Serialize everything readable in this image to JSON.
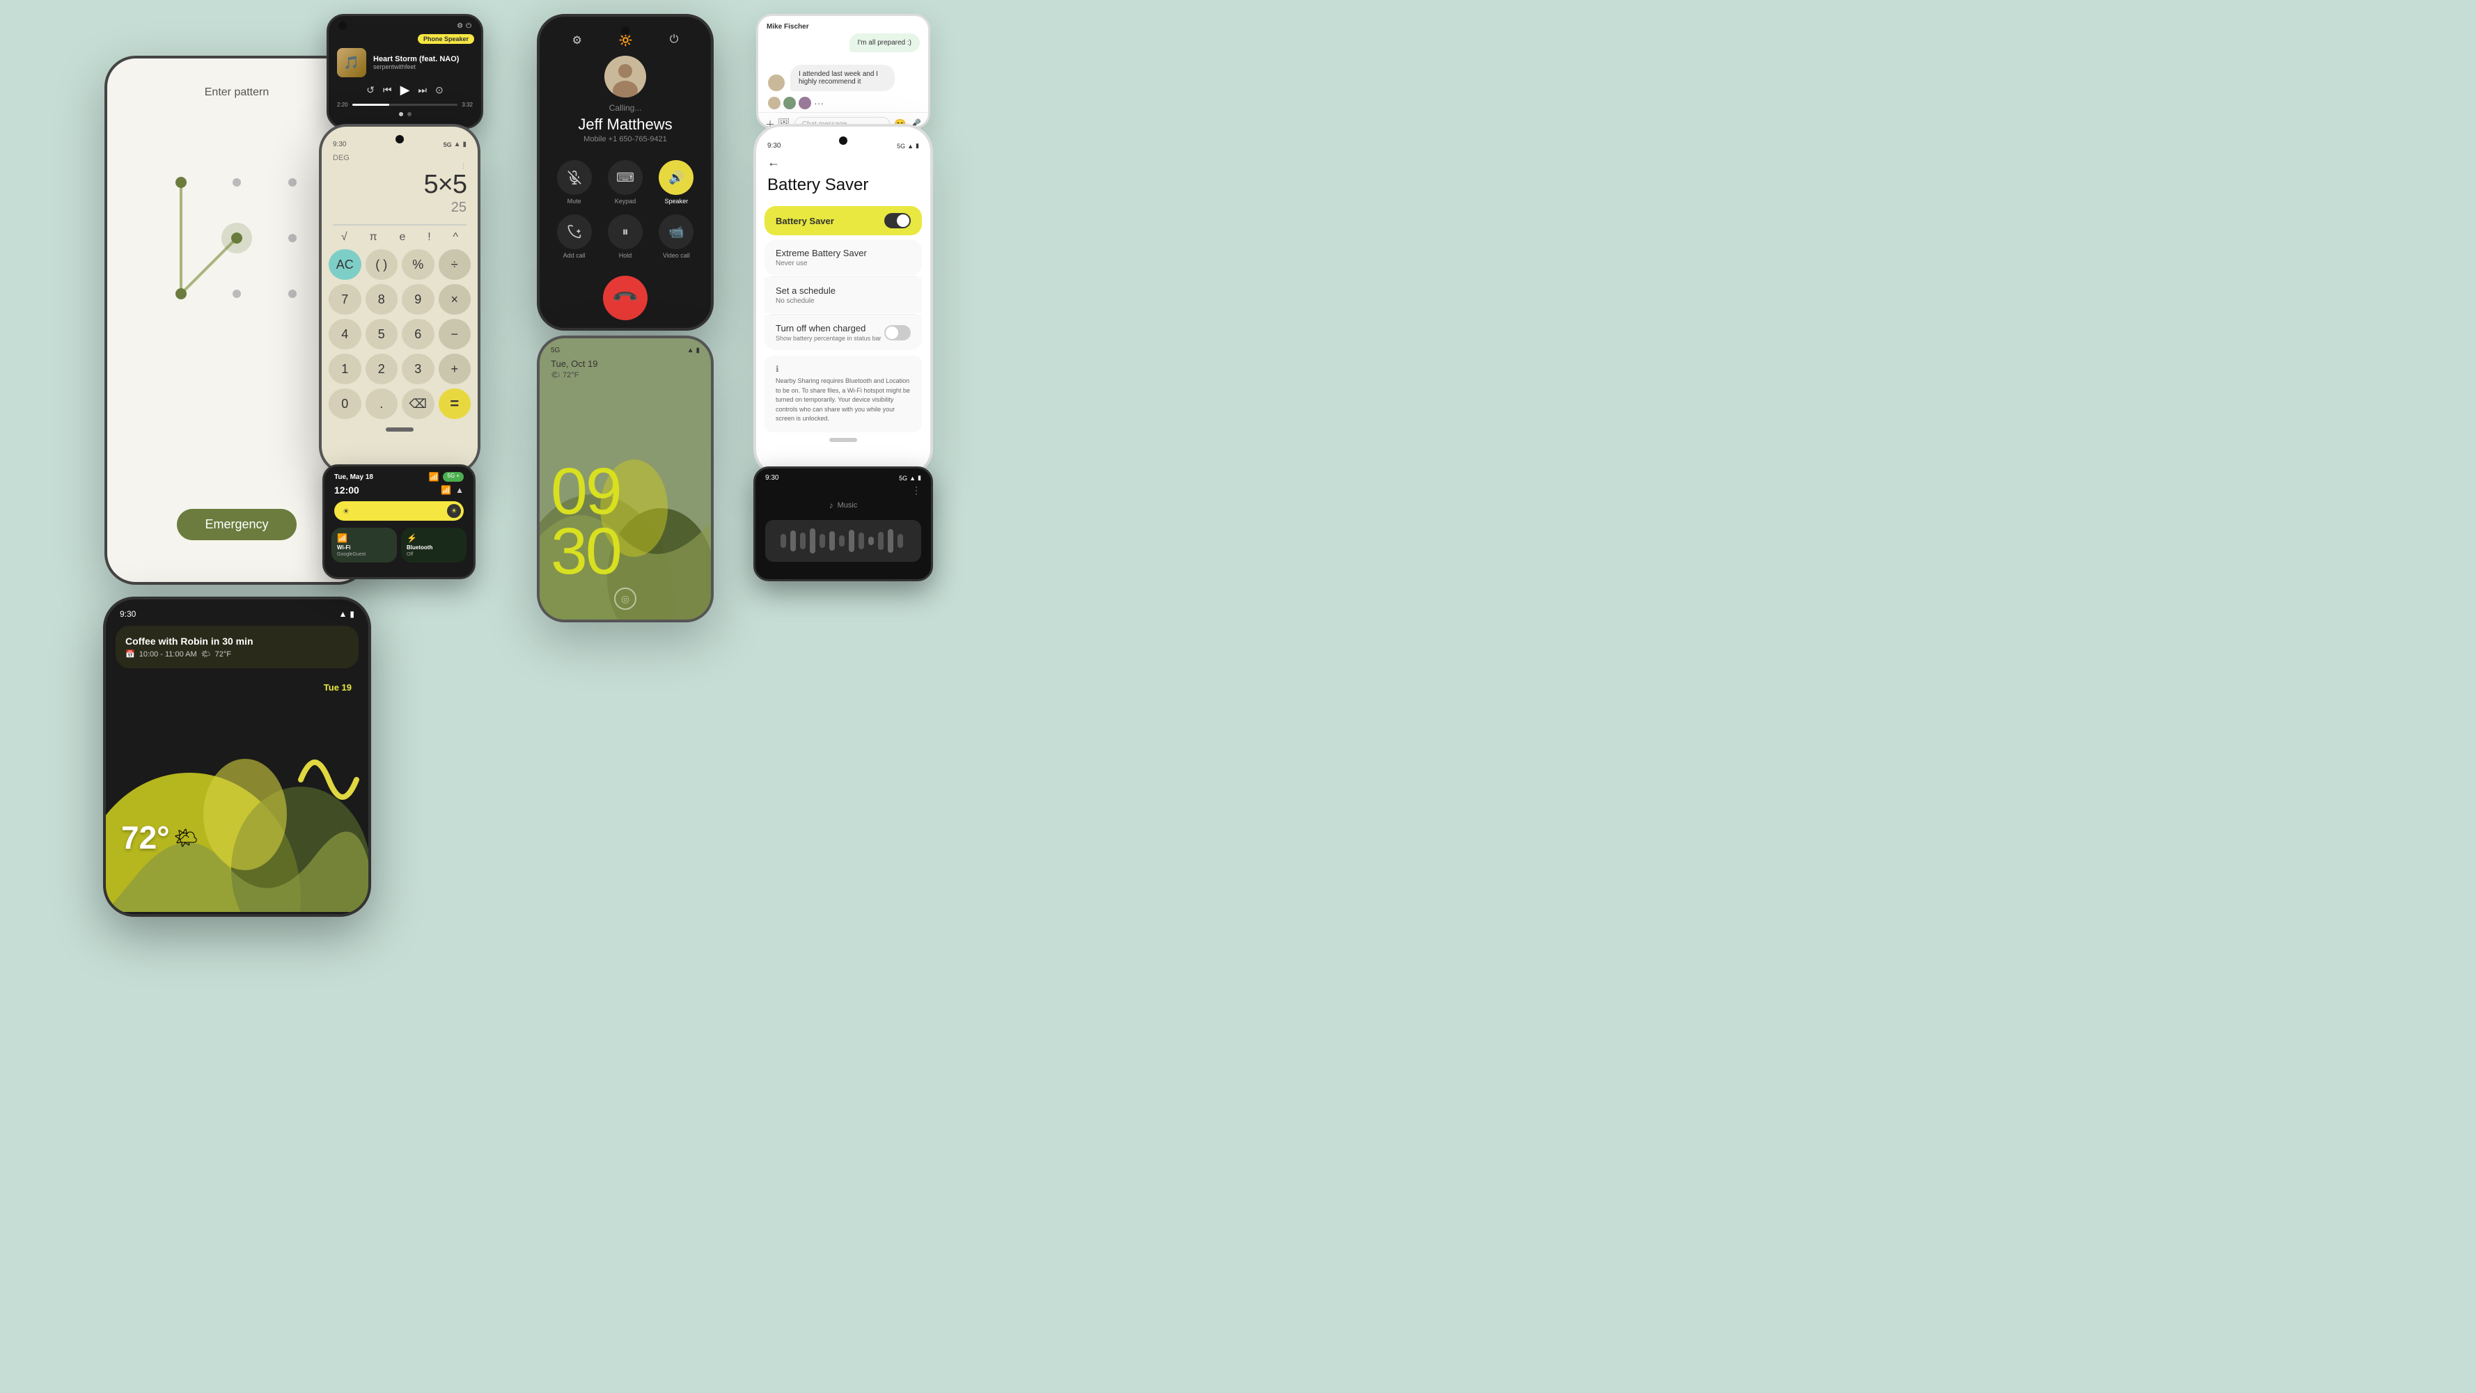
{
  "bg_color": "#c5ddd4",
  "phone1": {
    "enter_text": "Enter pattern",
    "emergency_label": "Emergency",
    "dots": [
      {
        "active": false
      },
      {
        "active": false
      },
      {
        "active": false
      },
      {
        "active": false
      },
      {
        "active": false
      },
      {
        "active": false
      },
      {
        "active": false
      },
      {
        "active": false
      },
      {
        "active": false
      }
    ]
  },
  "phone2": {
    "status_time": "9:30",
    "event_title": "Coffee with Robin in 30 min",
    "event_time": "10:00 - 11:00 AM",
    "event_weather": "72°F",
    "date_label": "Tue 19",
    "temp": "72°"
  },
  "phone3": {
    "pill_label": "Phone Speaker",
    "song_title": "Heart Storm (feat. NAO)",
    "artist": "serpentwithfeet",
    "time_current": "2:20",
    "time_total": "3:32"
  },
  "phone4": {
    "status_time": "9:30",
    "signal": "5G",
    "mode": "DEG",
    "expression": "5×5",
    "result": "25",
    "buttons": [
      {
        "label": "√",
        "type": "op"
      },
      {
        "label": "π",
        "type": "op"
      },
      {
        "label": "e",
        "type": "op"
      },
      {
        "label": "!",
        "type": "op"
      },
      {
        "label": "^",
        "type": "op"
      },
      {
        "label": "AC",
        "type": "teal"
      },
      {
        "label": "()",
        "type": "gray"
      },
      {
        "label": "%",
        "type": "gray"
      },
      {
        "label": "÷",
        "type": "op"
      },
      {
        "label": "7",
        "type": "gray"
      },
      {
        "label": "8",
        "type": "gray"
      },
      {
        "label": "9",
        "type": "gray"
      },
      {
        "label": "×",
        "type": "op"
      },
      {
        "label": "4",
        "type": "gray"
      },
      {
        "label": "5",
        "type": "gray"
      },
      {
        "label": "6",
        "type": "gray"
      },
      {
        "label": "−",
        "type": "op"
      },
      {
        "label": "1",
        "type": "gray"
      },
      {
        "label": "2",
        "type": "gray"
      },
      {
        "label": "3",
        "type": "gray"
      },
      {
        "label": "+",
        "type": "op"
      },
      {
        "label": "0",
        "type": "gray"
      },
      {
        "label": ".",
        "type": "gray"
      },
      {
        "label": "⌫",
        "type": "gray"
      },
      {
        "label": "=",
        "type": "yellow"
      }
    ]
  },
  "phone5": {
    "date": "Tue, May 18",
    "badge": "5G +",
    "time": "12:00",
    "wifi_name": "GoogleGuest",
    "wifi_label": "Wi-Fi",
    "bt_label": "Bluetooth",
    "bt_sub": "Off"
  },
  "phone6": {
    "calling_label": "Calling...",
    "contact_name": "Jeff Matthews",
    "phone_number": "Mobile +1 650-765-9421",
    "actions": [
      {
        "label": "Mute",
        "icon": "🎤"
      },
      {
        "label": "Keypad",
        "icon": "⌨"
      },
      {
        "label": "Speaker",
        "icon": "🔊",
        "active": true
      },
      {
        "label": "Add call",
        "icon": "📞"
      },
      {
        "label": "Hold",
        "icon": "⏸"
      },
      {
        "label": "Video call",
        "icon": "📹"
      }
    ]
  },
  "phone7": {
    "status_time": "5G",
    "date": "Tue, Oct 19",
    "weather": "72°F",
    "time_hour": "09",
    "time_min": "30"
  },
  "phone8": {
    "sender_name": "Mike Fischer",
    "message_them": "I attended last week and I highly recommend it",
    "message_me": "I'm all prepared :)",
    "input_placeholder": "Chat message"
  },
  "phone9": {
    "status_time": "9:30",
    "signal": "5G",
    "title": "Battery Saver",
    "battery_saver_label": "Battery Saver",
    "battery_saver_on": true,
    "extreme_label": "Extreme Battery Saver",
    "extreme_sub": "Never use",
    "schedule_label": "Set a schedule",
    "schedule_sub": "No schedule",
    "turnoff_label": "Turn off when charged",
    "turnoff_sub": "Show battery percentage in status bar",
    "info_text": "Nearby Sharing requires Bluetooth and Location to be on. To share files, a Wi-Fi hotspot might be turned on temporarily. Your device visibility controls who can share with you while your screen is unlocked."
  },
  "phone10": {
    "status_time": "9:30",
    "signal": "5G",
    "music_label": "Music"
  },
  "icons": {
    "back_arrow": "←",
    "phone": "📞",
    "end_call": "📞",
    "wifi": "WiFi",
    "bluetooth": "BT",
    "fingerprint": "◎",
    "settings": "⚙",
    "camera": "📷",
    "lock": "🔒",
    "mute": "🎤",
    "keypad": "⌨",
    "speaker": "🔊",
    "add_call": "📞+",
    "hold": "⏸",
    "video": "📹"
  }
}
